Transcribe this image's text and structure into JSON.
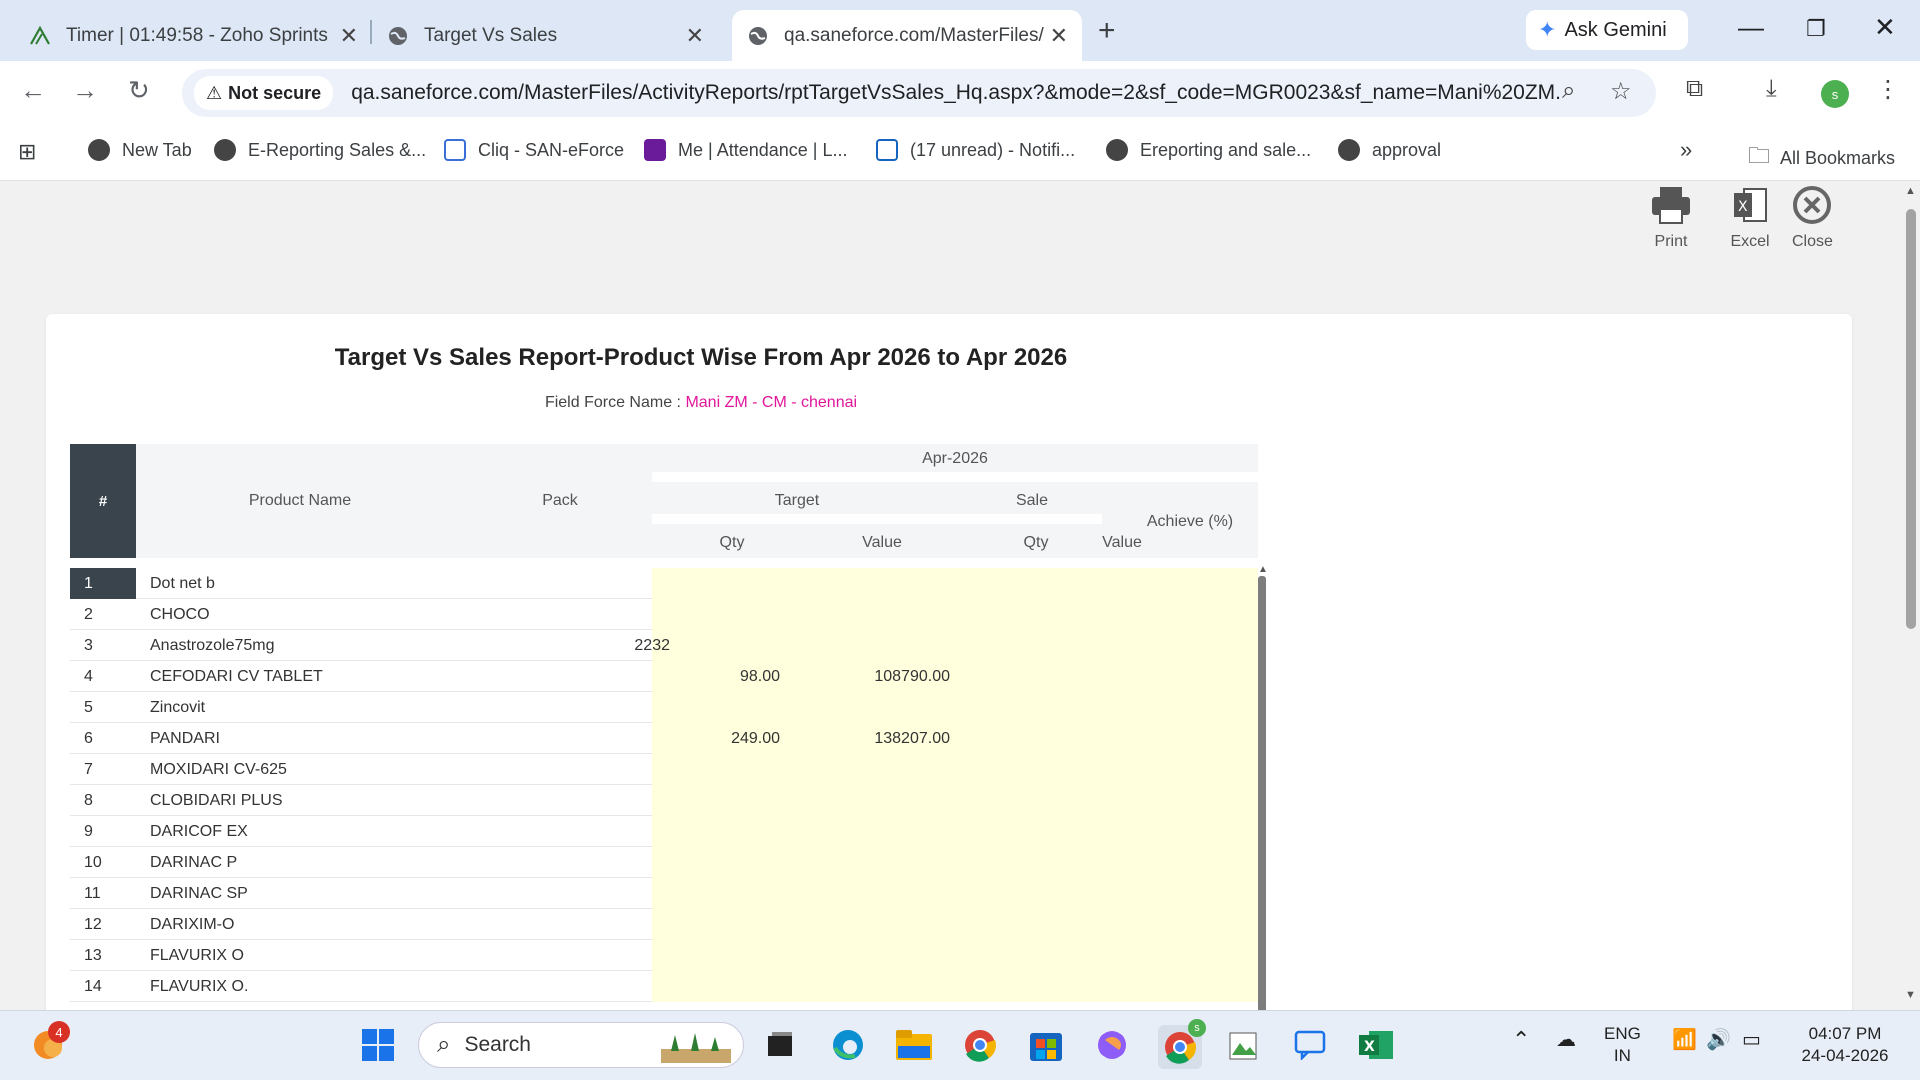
{
  "browser": {
    "tabs": [
      {
        "title": "Timer | 01:49:58 - Zoho Sprints",
        "icon": "zoho-sprints-icon"
      },
      {
        "title": "Target Vs Sales",
        "icon": "globe-icon"
      },
      {
        "title": "qa.saneforce.com/MasterFiles/A",
        "icon": "globe-icon"
      }
    ],
    "new_tab_symbol": "+",
    "ask_gemini": "Ask Gemini",
    "not_secure": "Not secure",
    "url": "qa.saneforce.com/MasterFiles/ActivityReports/rptTargetVsSales_Hq.aspx?&mode=2&sf_code=MGR0023&sf_name=Mani%20ZM...",
    "profile_initial": "s",
    "bookmarks": [
      "New Tab",
      "E-Reporting Sales &...",
      "Cliq - SAN-eForce",
      "Me | Attendance | L...",
      "(17 unread) - Notifi...",
      "Ereporting and sale...",
      "approval"
    ],
    "more_bookmarks": "»",
    "all_bookmarks": "All Bookmarks"
  },
  "actions": {
    "print": "Print",
    "excel": "Excel",
    "close": "Close"
  },
  "report": {
    "title": "Target Vs Sales Report-Product Wise From Apr 2026 to Apr 2026",
    "field_force_label": "Field Force Name :",
    "field_force_value": "Mani ZM - CM - chennai",
    "header": {
      "hash": "#",
      "product_name": "Product Name",
      "pack": "Pack",
      "month": "Apr-2026",
      "target": "Target",
      "sale": "Sale",
      "achieve": "Achieve (%)",
      "qty": "Qty",
      "value": "Value"
    },
    "rows": [
      {
        "n": "1",
        "product": "Dot net b",
        "pack": "",
        "tqty": "",
        "tval": ""
      },
      {
        "n": "2",
        "product": "CHOCO",
        "pack": "",
        "tqty": "",
        "tval": ""
      },
      {
        "n": "3",
        "product": "Anastrozole75mg",
        "pack": "2232",
        "tqty": "",
        "tval": ""
      },
      {
        "n": "4",
        "product": "CEFODARI CV TABLET",
        "pack": "",
        "tqty": "98.00",
        "tval": "108790.00"
      },
      {
        "n": "5",
        "product": "Zincovit",
        "pack": "",
        "tqty": "",
        "tval": ""
      },
      {
        "n": "6",
        "product": "PANDARI",
        "pack": "",
        "tqty": "249.00",
        "tval": "138207.00"
      },
      {
        "n": "7",
        "product": "MOXIDARI CV-625",
        "pack": "",
        "tqty": "",
        "tval": ""
      },
      {
        "n": "8",
        "product": "CLOBIDARI PLUS",
        "pack": "",
        "tqty": "",
        "tval": ""
      },
      {
        "n": "9",
        "product": "DARICOF EX",
        "pack": "",
        "tqty": "",
        "tval": ""
      },
      {
        "n": "10",
        "product": "DARINAC P",
        "pack": "",
        "tqty": "",
        "tval": ""
      },
      {
        "n": "11",
        "product": "DARINAC SP",
        "pack": "",
        "tqty": "",
        "tval": ""
      },
      {
        "n": "12",
        "product": "DARIXIM-O",
        "pack": "",
        "tqty": "",
        "tval": ""
      },
      {
        "n": "13",
        "product": "FLAVURIX O",
        "pack": "",
        "tqty": "",
        "tval": ""
      },
      {
        "n": "14",
        "product": "FLAVURIX O.",
        "pack": "",
        "tqty": "",
        "tval": ""
      }
    ]
  },
  "taskbar": {
    "search_placeholder": "Search",
    "widget_badge": "4",
    "chrome_badge": "s",
    "lang_top": "ENG",
    "lang_bottom": "IN",
    "time": "04:07 PM",
    "date": "24-04-2026"
  },
  "colors": {
    "accent_magenta": "#e0179a",
    "header_dark": "#3a444d",
    "cell_yellow": "#ffffdd"
  }
}
